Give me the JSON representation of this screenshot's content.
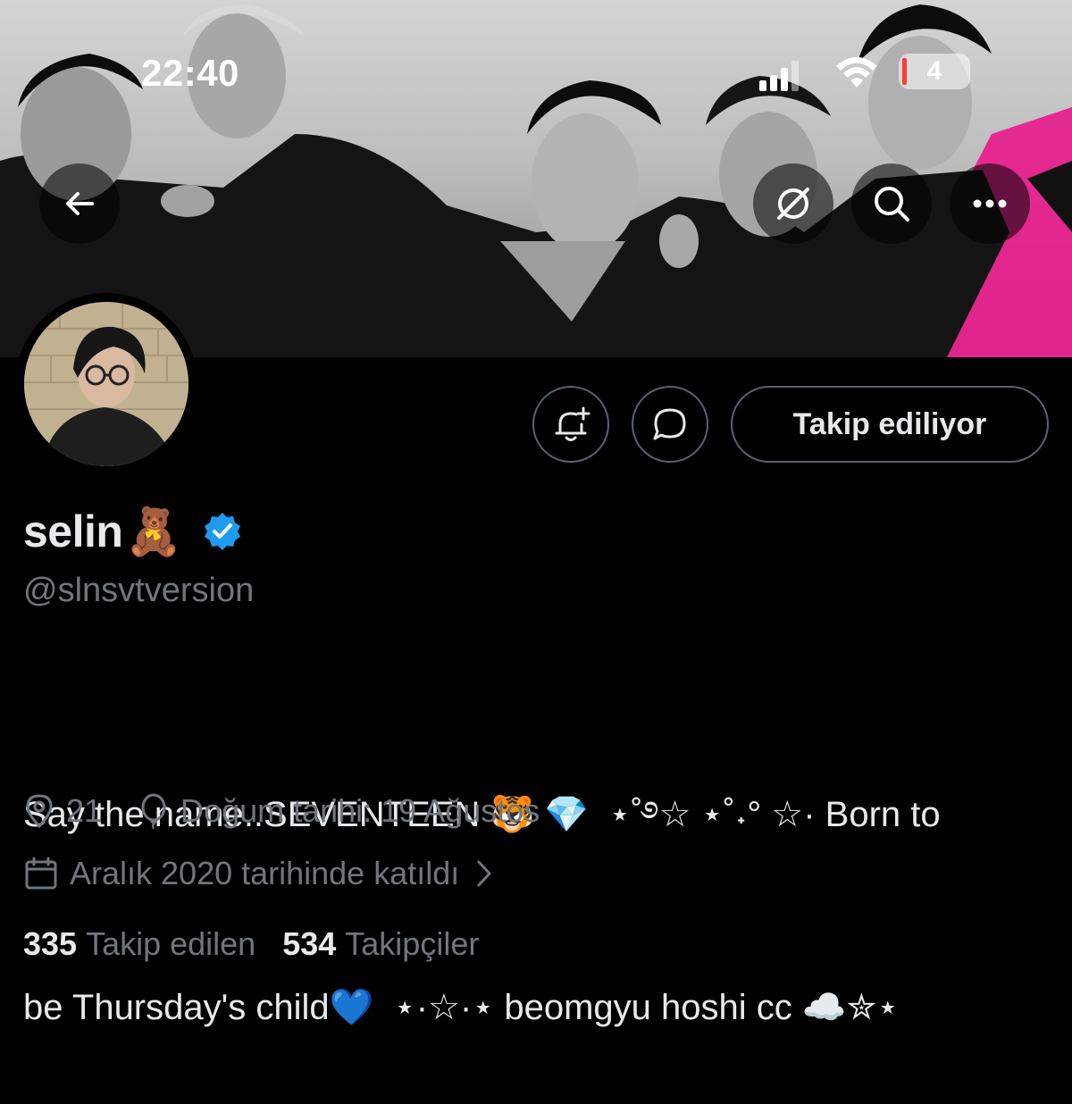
{
  "status_bar": {
    "time": "22:40",
    "battery_level": "4"
  },
  "header": {
    "back_icon": "arrow-left-icon",
    "grok_icon": "grok-icon",
    "search_icon": "search-icon",
    "more_icon": "more-dots-icon"
  },
  "profile": {
    "display_name": "selin",
    "name_emoji": "🧸",
    "verified": true,
    "verified_color": "#1d9bf0",
    "handle": "@slnsvtversion",
    "bio_line1": "Say the name..SEVENTEEN 🐯 💎  ⋆˚࿔☆ ⋆˚˖° ☆· Born to",
    "bio_line2": "be Thursday's child💙  ⋆·☆·⋆ beomgyu hoshi cc ☁️✮⋆",
    "location": "21",
    "birthday": "Doğum tarihi: 19 Ağustos",
    "joined": "Aralık 2020 tarihinde katıldı",
    "following_count": "335",
    "following_label": "Takip edilen",
    "followers_count": "534",
    "followers_label": "Takipçiler"
  },
  "actions": {
    "notify_icon": "bell-plus-icon",
    "message_icon": "message-bubble-icon",
    "follow_label": "Takip ediliyor"
  },
  "colors": {
    "background": "#000000",
    "text_primary": "#e7e9ea",
    "text_secondary": "#71767b",
    "border": "#536471",
    "banner_accent": "#e8198b"
  }
}
